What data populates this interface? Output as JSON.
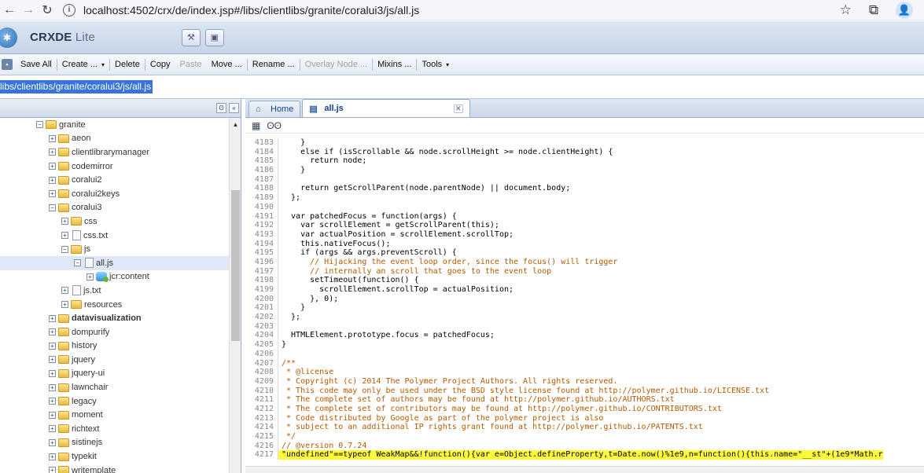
{
  "browser": {
    "back": "←",
    "forward": "→",
    "reload": "↻",
    "url": "localhost:4502/crx/de/index.jsp#/libs/clientlibs/granite/coralui3/js/all.js",
    "info_glyph": "i",
    "bookmark_glyph": "☆",
    "extension_glyph": "⧉",
    "profile_glyph": "👤"
  },
  "header": {
    "title_main": "CRXDE",
    "title_sub": " Lite"
  },
  "toolbar": {
    "save_all": "Save All",
    "create": "Create ...",
    "delete": "Delete",
    "copy": "Copy",
    "paste": "Paste",
    "move": "Move ...",
    "rename": "Rename ...",
    "overlay_node": "Overlay Node ...",
    "mixins": "Mixins ...",
    "tools": "Tools",
    "caret": "▾"
  },
  "path": {
    "value": "libs/clientlibs/granite/coralui3/js/all.js"
  },
  "tree": {
    "items": [
      {
        "label": "granite",
        "toggle": "−",
        "kind": "folder"
      },
      {
        "label": "aeon",
        "toggle": "+",
        "kind": "folder"
      },
      {
        "label": "clientlibrarymanager",
        "toggle": "+",
        "kind": "folder"
      },
      {
        "label": "codemirror",
        "toggle": "+",
        "kind": "folder"
      },
      {
        "label": "coralui2",
        "toggle": "+",
        "kind": "folder"
      },
      {
        "label": "coralui2keys",
        "toggle": "+",
        "kind": "folder"
      },
      {
        "label": "coralui3",
        "toggle": "−",
        "kind": "folder"
      },
      {
        "label": "css",
        "toggle": "+",
        "kind": "folder"
      },
      {
        "label": "css.txt",
        "toggle": "+",
        "kind": "file"
      },
      {
        "label": "js",
        "toggle": "−",
        "kind": "folder"
      },
      {
        "label": "all.js",
        "toggle": "−",
        "kind": "file"
      },
      {
        "label": "jcr:content",
        "toggle": "+",
        "kind": "node"
      },
      {
        "label": "js.txt",
        "toggle": "+",
        "kind": "file"
      },
      {
        "label": "resources",
        "toggle": "+",
        "kind": "folder"
      },
      {
        "label": "datavisualization",
        "toggle": "+",
        "kind": "folder"
      },
      {
        "label": "dompurify",
        "toggle": "+",
        "kind": "folder"
      },
      {
        "label": "history",
        "toggle": "+",
        "kind": "folder"
      },
      {
        "label": "jquery",
        "toggle": "+",
        "kind": "folder"
      },
      {
        "label": "jquery-ui",
        "toggle": "+",
        "kind": "folder"
      },
      {
        "label": "lawnchair",
        "toggle": "+",
        "kind": "folder"
      },
      {
        "label": "legacy",
        "toggle": "+",
        "kind": "folder"
      },
      {
        "label": "moment",
        "toggle": "+",
        "kind": "folder"
      },
      {
        "label": "richtext",
        "toggle": "+",
        "kind": "folder"
      },
      {
        "label": "sistinejs",
        "toggle": "+",
        "kind": "folder"
      },
      {
        "label": "typekit",
        "toggle": "+",
        "kind": "folder"
      },
      {
        "label": "writemplate",
        "toggle": "+",
        "kind": "folder"
      }
    ],
    "scroll_up": "▲"
  },
  "tabs": [
    {
      "label": "Home",
      "icon": "⌂"
    },
    {
      "label": "all.js",
      "icon": "▤",
      "close": "✕"
    }
  ],
  "editor": {
    "lines": [
      {
        "n": "4183",
        "t": "    }"
      },
      {
        "n": "4184",
        "t": "    else if (isScrollable && node.scrollHeight >= node.clientHeight) {"
      },
      {
        "n": "4185",
        "t": "      return node;"
      },
      {
        "n": "4186",
        "t": "    }"
      },
      {
        "n": "4187",
        "t": ""
      },
      {
        "n": "4188",
        "t": "    return getScrollParent(node.parentNode) || document.body;"
      },
      {
        "n": "4189",
        "t": "  };"
      },
      {
        "n": "4190",
        "t": ""
      },
      {
        "n": "4191",
        "t": "  var patchedFocus = function(args) {"
      },
      {
        "n": "4192",
        "t": "    var scrollElement = getScrollParent(this);"
      },
      {
        "n": "4193",
        "t": "    var actualPosition = scrollElement.scrollTop;"
      },
      {
        "n": "4194",
        "t": "    this.nativeFocus();"
      },
      {
        "n": "4195",
        "t": "    if (args && args.preventScroll) {"
      },
      {
        "n": "4196",
        "t": "      // Hijacking the event loop order, since the focus() will trigger",
        "c": true
      },
      {
        "n": "4197",
        "t": "      // internally an scroll that goes to the event loop",
        "c": true
      },
      {
        "n": "4198",
        "t": "      setTimeout(function() {"
      },
      {
        "n": "4199",
        "t": "        scrollElement.scrollTop = actualPosition;"
      },
      {
        "n": "4200",
        "t": "      }, 0);"
      },
      {
        "n": "4201",
        "t": "    }"
      },
      {
        "n": "4202",
        "t": "  };"
      },
      {
        "n": "4203",
        "t": ""
      },
      {
        "n": "4204",
        "t": "  HTMLElement.prototype.focus = patchedFocus;"
      },
      {
        "n": "4205",
        "t": "}"
      },
      {
        "n": "4206",
        "t": ""
      },
      {
        "n": "4207",
        "t": "/**",
        "c": true
      },
      {
        "n": "4208",
        "t": " * @license",
        "c": true
      },
      {
        "n": "4209",
        "t": " * Copyright (c) 2014 The Polymer Project Authors. All rights reserved.",
        "c": true
      },
      {
        "n": "4210",
        "t": " * This code may only be used under the BSD style license found at http://polymer.github.io/LICENSE.txt",
        "c": true
      },
      {
        "n": "4211",
        "t": " * The complete set of authors may be found at http://polymer.github.io/AUTHORS.txt",
        "c": true
      },
      {
        "n": "4212",
        "t": " * The complete set of contributors may be found at http://polymer.github.io/CONTRIBUTORS.txt",
        "c": true
      },
      {
        "n": "4213",
        "t": " * Code distributed by Google as part of the polymer project is also",
        "c": true
      },
      {
        "n": "4214",
        "t": " * subject to an additional IP rights grant found at http://polymer.github.io/PATENTS.txt",
        "c": true
      },
      {
        "n": "4215",
        "t": " */",
        "c": true
      },
      {
        "n": "4216",
        "t": "// @version 0.7.24",
        "c": true
      },
      {
        "n": "4217",
        "t": "\"undefined\"==typeof WeakMap&&!function(){var e=Object.defineProperty,t=Date.now()%1e9,n=function(){this.name=\"__st\"+(1e9*Math.r",
        "h": true
      }
    ]
  },
  "colors": {
    "accent": "#3874d8",
    "highlight": "#fff93a",
    "comment": "#b35a00"
  }
}
